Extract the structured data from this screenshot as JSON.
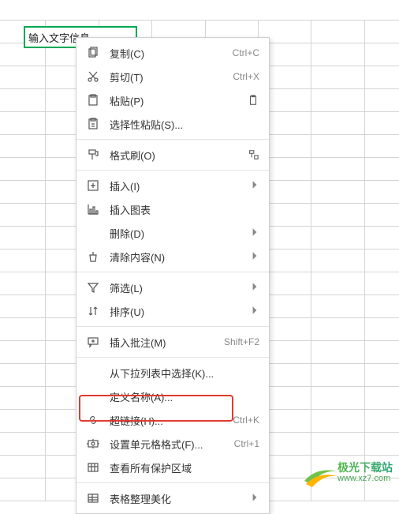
{
  "cell": {
    "text": "输入文字信息"
  },
  "menu": {
    "copy": {
      "label": "复制(C)",
      "shortcut": "Ctrl+C"
    },
    "cut": {
      "label": "剪切(T)",
      "shortcut": "Ctrl+X"
    },
    "paste": {
      "label": "粘贴(P)"
    },
    "pasteSpecial": {
      "label": "选择性粘贴(S)..."
    },
    "formatPaint": {
      "label": "格式刷(O)"
    },
    "insert": {
      "label": "插入(I)"
    },
    "insertChart": {
      "label": "插入图表"
    },
    "delete": {
      "label": "删除(D)"
    },
    "clear": {
      "label": "清除内容(N)"
    },
    "filter": {
      "label": "筛选(L)"
    },
    "sort": {
      "label": "排序(U)"
    },
    "comment": {
      "label": "插入批注(M)",
      "shortcut": "Shift+F2"
    },
    "dropdown": {
      "label": "从下拉列表中选择(K)..."
    },
    "defineName": {
      "label": "定义名称(A)..."
    },
    "hyperlink": {
      "label": "超链接(H)...",
      "shortcut": "Ctrl+K"
    },
    "cellFormat": {
      "label": "设置单元格格式(F)...",
      "shortcut": "Ctrl+1"
    },
    "protect": {
      "label": "查看所有保护区域"
    },
    "tableBeauty": {
      "label": "表格整理美化"
    }
  },
  "watermark": {
    "line1": "极光下载站",
    "line2": "www.xz7.com"
  }
}
